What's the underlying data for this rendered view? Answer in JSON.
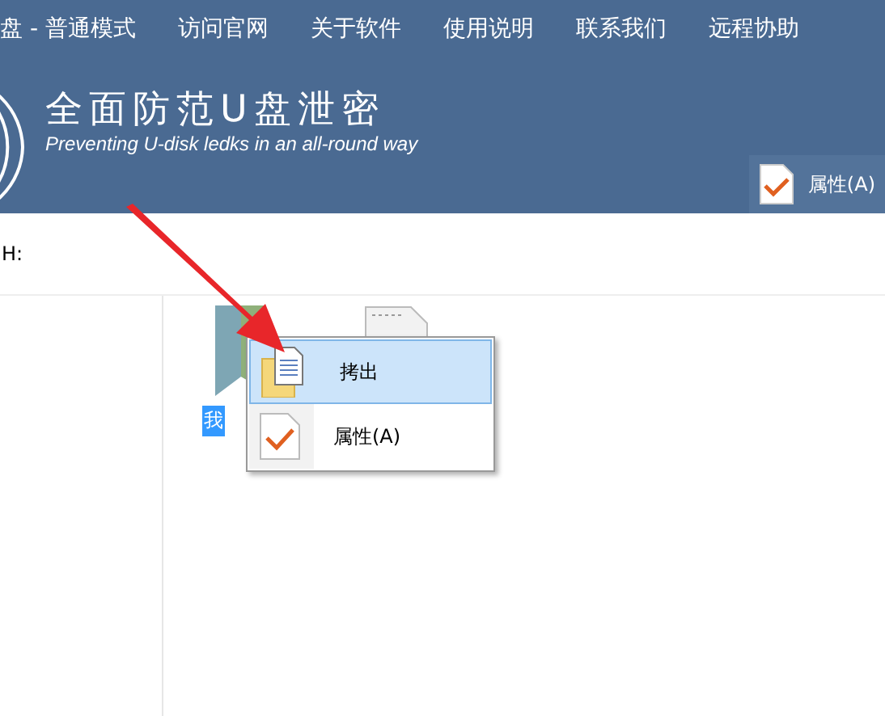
{
  "menu_bar": {
    "items": [
      {
        "label": "盘 - 普通模式"
      },
      {
        "label": "访问官网"
      },
      {
        "label": "关于软件"
      },
      {
        "label": "使用说明"
      },
      {
        "label": "联系我们"
      },
      {
        "label": "远程协助"
      }
    ]
  },
  "banner": {
    "title": "全面防范U盘泄密",
    "subtitle": "Preventing U-disk ledks in an all-round way"
  },
  "toolbar": {
    "buttons": [
      {
        "label": "属性(A)",
        "kind": "properties"
      }
    ]
  },
  "address": {
    "path": "H:"
  },
  "files": [
    {
      "kind": "folder",
      "name": "我",
      "selected": true
    },
    {
      "kind": "document"
    }
  ],
  "context_menu": {
    "items": [
      {
        "label": "拷出",
        "kind": "copy",
        "selected": true
      },
      {
        "label": "属性(A)",
        "kind": "properties",
        "selected": false
      }
    ]
  }
}
